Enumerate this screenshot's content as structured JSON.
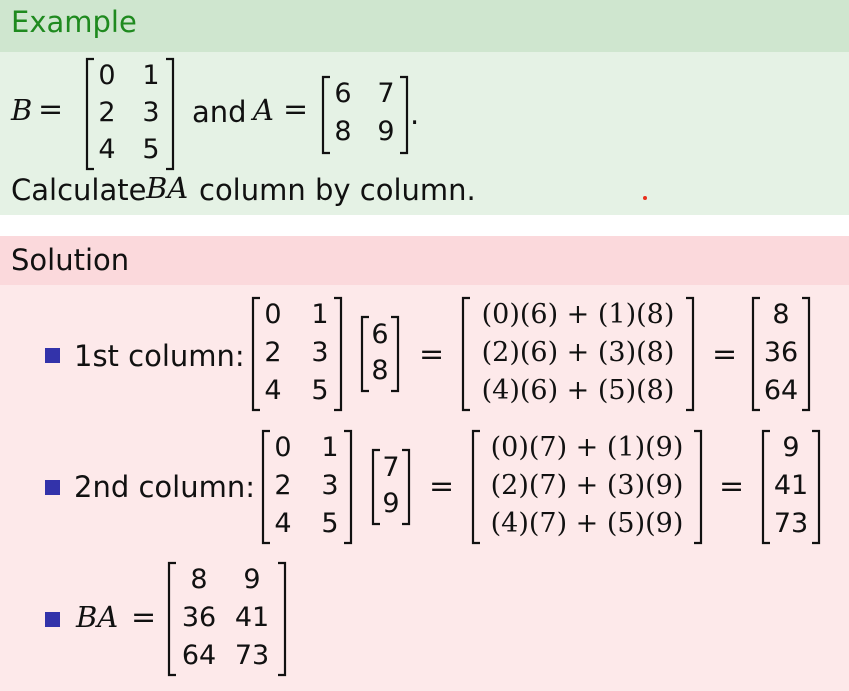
{
  "example": {
    "title": "Example",
    "B_symbol": "B",
    "equals": "=",
    "and_text": "and",
    "A_symbol": "A",
    "period": ".",
    "matrix_B": [
      [
        "0",
        "1"
      ],
      [
        "2",
        "3"
      ],
      [
        "4",
        "5"
      ]
    ],
    "matrix_A": [
      [
        "6",
        "7"
      ],
      [
        "8",
        "9"
      ]
    ],
    "instruction_prefix": "Calculate",
    "instruction_symbol": "BA",
    "instruction_suffix": "column by column."
  },
  "solution": {
    "title": "Solution",
    "rows": [
      {
        "label": "1st column:",
        "left_matrix": [
          [
            "0",
            "1"
          ],
          [
            "2",
            "3"
          ],
          [
            "4",
            "5"
          ]
        ],
        "vector": [
          "6",
          "8"
        ],
        "products": [
          "(0)(6) + (1)(8)",
          "(2)(6) + (3)(8)",
          "(4)(6) + (5)(8)"
        ],
        "result": [
          "8",
          "36",
          "64"
        ]
      },
      {
        "label": "2nd column:",
        "left_matrix": [
          [
            "0",
            "1"
          ],
          [
            "2",
            "3"
          ],
          [
            "4",
            "5"
          ]
        ],
        "vector": [
          "7",
          "9"
        ],
        "products": [
          "(0)(7) + (1)(9)",
          "(2)(7) + (3)(9)",
          "(4)(7) + (5)(9)"
        ],
        "result": [
          "9",
          "41",
          "73"
        ]
      }
    ],
    "final_symbol": "BA",
    "final_equals": "=",
    "final_matrix": [
      [
        "8",
        "9"
      ],
      [
        "36",
        "41"
      ],
      [
        "64",
        "73"
      ]
    ],
    "equals": "="
  },
  "colors": {
    "example_header_bg": "#cfe6cf",
    "example_body_bg": "#e5f2e5",
    "example_title": "#1f8a1f",
    "solution_header_bg": "#fbd9dc",
    "solution_body_bg": "#fde9ea",
    "bullet": "#3333aa"
  }
}
